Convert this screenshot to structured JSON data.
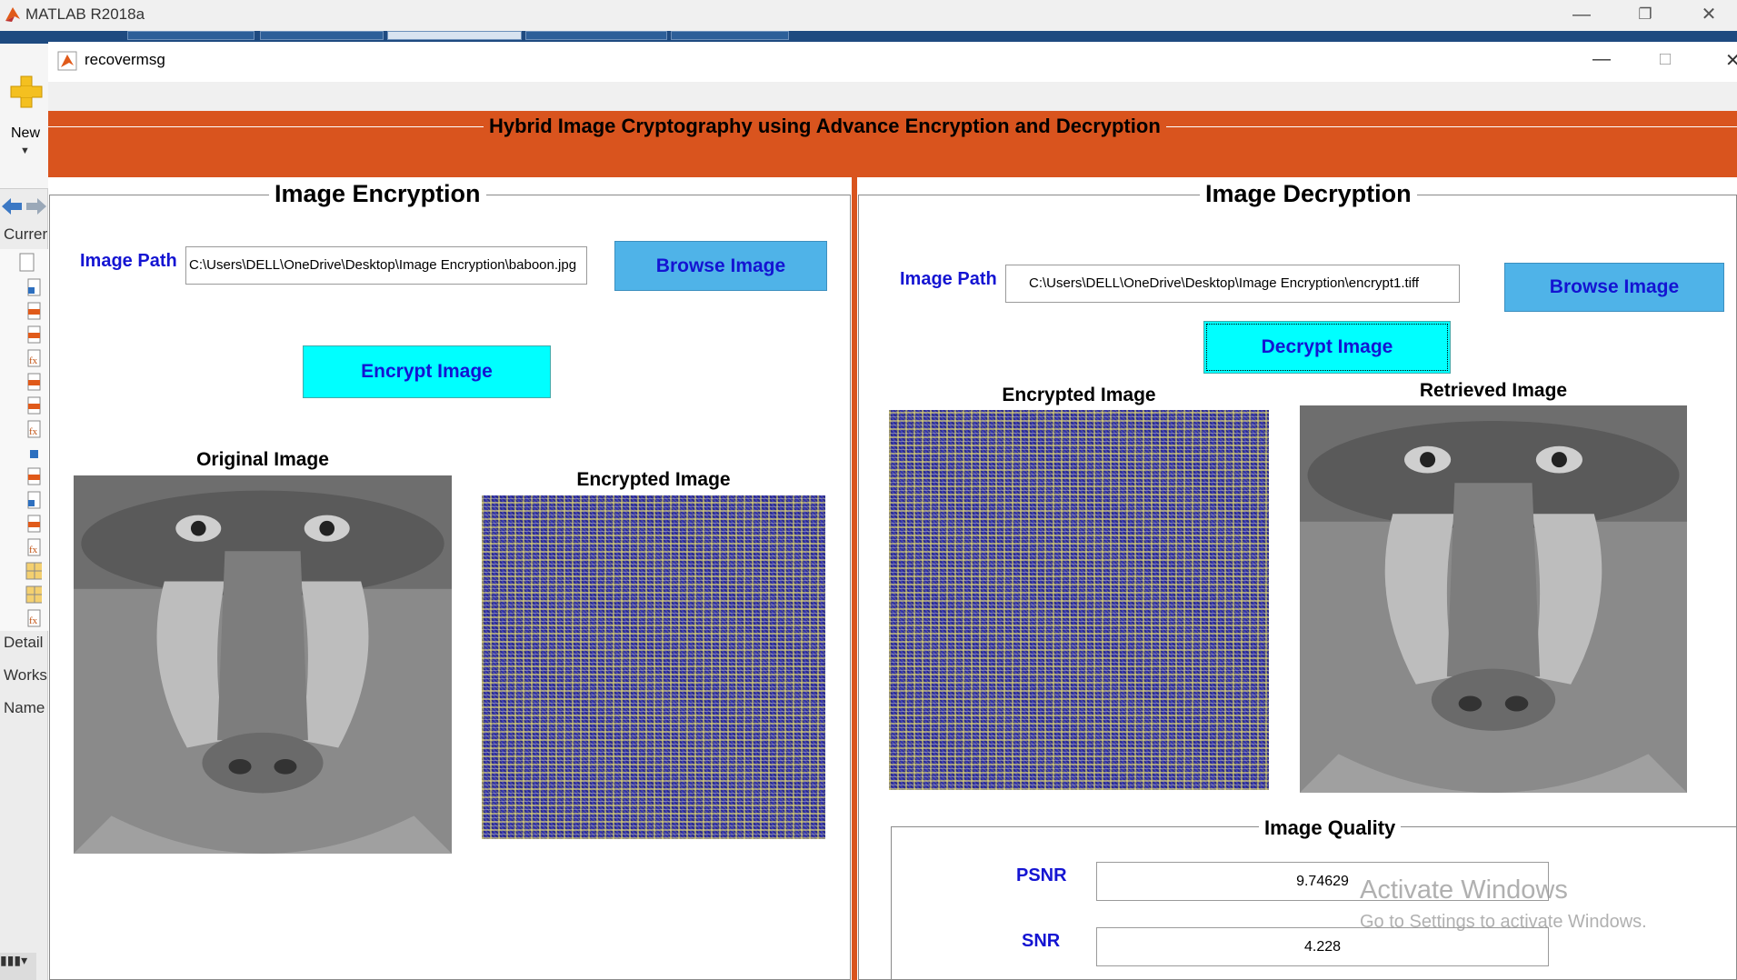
{
  "matlab": {
    "title": "MATLAB R2018a",
    "new_label": "New",
    "left_labels": [
      "Currer",
      "Detail",
      "Works",
      "Name"
    ]
  },
  "figure": {
    "title": "recovermsg",
    "banner_title": "Hybrid Image Cryptography using Advance Encryption and Decryption"
  },
  "encryption": {
    "title": "Image Encryption",
    "path_label": "Image Path",
    "path_value": "C:\\Users\\DELL\\OneDrive\\Desktop\\Image Encryption\\baboon.jpg",
    "browse_label": "Browse Image",
    "encrypt_label": "Encrypt Image",
    "original_caption": "Original Image",
    "encrypted_caption": "Encrypted Image"
  },
  "decryption": {
    "title": "Image Decryption",
    "path_label": "Image Path",
    "path_value": "C:\\Users\\DELL\\OneDrive\\Desktop\\Image Encryption\\encrypt1.tiff",
    "browse_label": "Browse Image",
    "decrypt_label": "Decrypt Image",
    "encrypted_caption": "Encrypted  Image",
    "retrieved_caption": "Retrieved Image"
  },
  "quality": {
    "title": "Image Quality",
    "psnr_label": "PSNR",
    "psnr_value": "9.74629",
    "snr_label": "SNR",
    "snr_value": "4.228"
  },
  "watermark": {
    "line1": "Activate Windows",
    "line2": "Go to Settings to activate Windows."
  },
  "colors": {
    "banner": "#d9541e",
    "browse_button": "#4fb3e8",
    "action_button": "#00ffff",
    "label_text": "#1414d2"
  }
}
